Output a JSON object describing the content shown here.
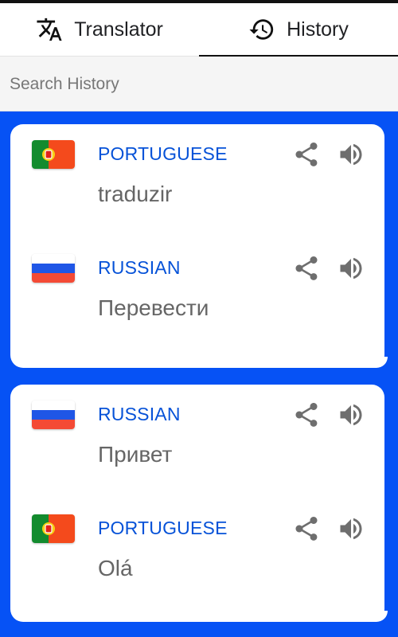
{
  "tabs": [
    {
      "label": "Translator",
      "icon": "translate-icon"
    },
    {
      "label": "History",
      "icon": "history-icon"
    }
  ],
  "search": {
    "placeholder": "Search History",
    "value": ""
  },
  "colors": {
    "accent": "#0652f5",
    "language": "#0652d8",
    "text": "#666666"
  },
  "cards": [
    {
      "entries": [
        {
          "language": "PORTUGUESE",
          "text": "traduzir",
          "flag": "portugal-flag-icon"
        },
        {
          "language": "RUSSIAN",
          "text": "Перевести",
          "flag": "russia-flag-icon"
        }
      ]
    },
    {
      "entries": [
        {
          "language": "RUSSIAN",
          "text": "Привет",
          "flag": "russia-flag-icon"
        },
        {
          "language": "PORTUGUESE",
          "text": "Olá",
          "flag": "portugal-flag-icon"
        }
      ]
    }
  ]
}
